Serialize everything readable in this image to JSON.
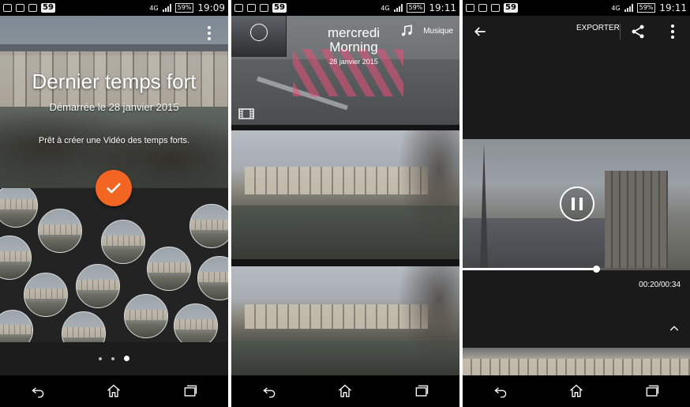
{
  "status_bar": {
    "badge": "59",
    "battery": "59%",
    "network": "4G",
    "time_1": "19:09",
    "time_2": "19:11",
    "time_3": "19:11"
  },
  "screen1": {
    "title": "Dernier temps fort",
    "subtitle": "Démarrée le 28 janvier 2015",
    "description": "Prêt à créer une Vidéo des temps forts.",
    "page_count": 3,
    "active_page": 3
  },
  "screen2": {
    "music_label": "Musique",
    "day_title_line1": "mercredi",
    "day_title_line2": "Morning",
    "day_date": "28 janvier 2015"
  },
  "screen3": {
    "export_label": "EXPORTER",
    "time_code": "00:20/00:34",
    "progress_fraction": 0.588
  },
  "colors": {
    "accent": "#f26522",
    "status_bar": "#000000",
    "panel_dark": "#1c1c1c"
  },
  "icons": [
    "overflow-menu-icon",
    "checkmark-icon",
    "music-note-icon",
    "film-icon",
    "back-arrow-icon",
    "share-icon",
    "pause-icon",
    "chevron-up-icon",
    "nav-back-icon",
    "nav-home-icon",
    "nav-recents-icon"
  ]
}
